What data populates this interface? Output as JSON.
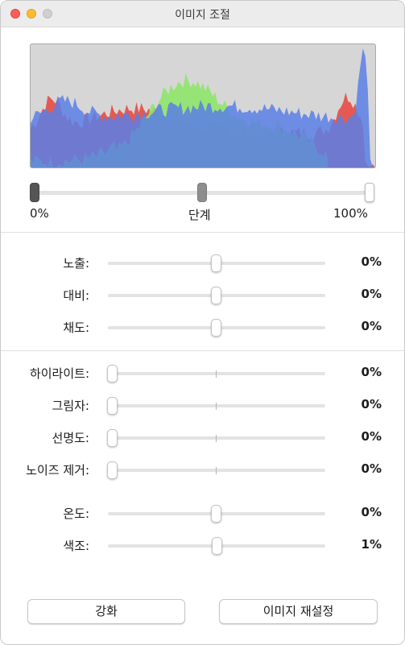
{
  "window": {
    "title": "이미지 조절"
  },
  "histogram": {
    "colors": {
      "red": "#e5534b",
      "green": "#8fe56a",
      "blue": "#5a7fe6",
      "background": "#d6d6d6"
    }
  },
  "levels": {
    "left_label": "0%",
    "mid_label": "단계",
    "right_label": "100%",
    "black_point": 0.0,
    "mid_point": 0.5,
    "white_point": 1.0
  },
  "adjustments_group1": [
    {
      "label": "노출:",
      "value": "0%",
      "position": 0.5
    },
    {
      "label": "대비:",
      "value": "0%",
      "position": 0.5
    },
    {
      "label": "채도:",
      "value": "0%",
      "position": 0.5
    }
  ],
  "adjustments_group2": [
    {
      "label": "하이라이트:",
      "value": "0%",
      "position": 0.0
    },
    {
      "label": "그림자:",
      "value": "0%",
      "position": 0.0
    },
    {
      "label": "선명도:",
      "value": "0%",
      "position": 0.0
    },
    {
      "label": "노이즈 제거:",
      "value": "0%",
      "position": 0.0
    }
  ],
  "adjustments_group3": [
    {
      "label": "온도:",
      "value": "0%",
      "position": 0.5
    },
    {
      "label": "색조:",
      "value": "1%",
      "position": 0.505
    }
  ],
  "buttons": {
    "enhance": "강화",
    "reset": "이미지 재설정"
  }
}
